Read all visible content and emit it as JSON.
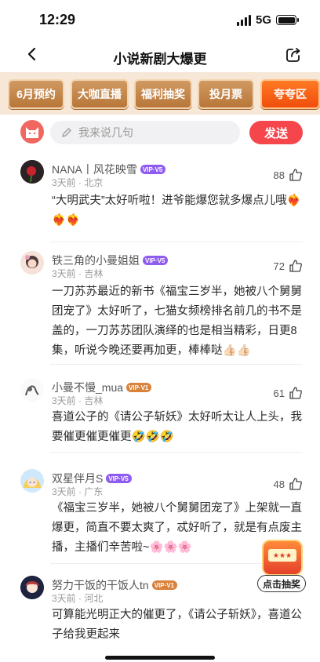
{
  "status_bar": {
    "time": "12:29",
    "network": "5G"
  },
  "nav": {
    "title": "小说新剧大爆更"
  },
  "tabs": [
    {
      "label": "6月预约"
    },
    {
      "label": "大咖直播"
    },
    {
      "label": "福利抽奖"
    },
    {
      "label": "投月票"
    },
    {
      "label": "夸夸区",
      "active": true
    }
  ],
  "composer": {
    "placeholder": "我来说几句",
    "send_label": "发送"
  },
  "comments": [
    {
      "name": "NANA丨风花映雪",
      "vip": "V5",
      "meta": "3天前 · 北京",
      "likes": "88",
      "text": "“大明武夫”太好听啦！进爷能爆您就多爆点儿哦❤️‍🔥❤️‍🔥❤️‍🔥"
    },
    {
      "name": "铁三角的小曼姐姐",
      "vip": "V5",
      "meta": "3天前 · 吉林",
      "likes": "72",
      "text": "一刀苏苏最近的新书《福宝三岁半，她被八个舅舅团宠了》太好听了，七猫女频榜排名前几的书不是盖的，一刀苏苏团队演绎的也是相当精彩，日更8集，听说今晚还要再加更，棒棒哒👍🏻👍🏻"
    },
    {
      "name": "小曼不慢_mua",
      "vip": "V1",
      "meta": "3天前 · 吉林",
      "likes": "61",
      "text": "喜道公子的《请公子斩妖》太好听太让人上头，我要催更催更催更🤣🤣🤣"
    },
    {
      "name": "双星伴月S",
      "vip": "V5",
      "meta": "3天前 · 广东",
      "likes": "48",
      "text": "《福宝三岁半，她被八个舅舅团宠了》上架就一直爆更，简直不要太爽了，忒好听了，就是有点废主播，主播们辛苦啦~🌸🌸🌸"
    },
    {
      "name": "努力干饭的干饭人tn",
      "vip": "V1",
      "meta": "3天前 · 河北",
      "likes": "",
      "text": "可算能光明正大的催更了，《请公子斩妖》，喜道公子给我更起来"
    }
  ],
  "lottery": {
    "label": "点击抽奖",
    "reels": "★★★"
  },
  "colors": {
    "accent": "#f5464c",
    "tab_bg": "#f6e7d6",
    "tab_active": "#f04d0c",
    "vip_purple": "#8e5cf0"
  }
}
